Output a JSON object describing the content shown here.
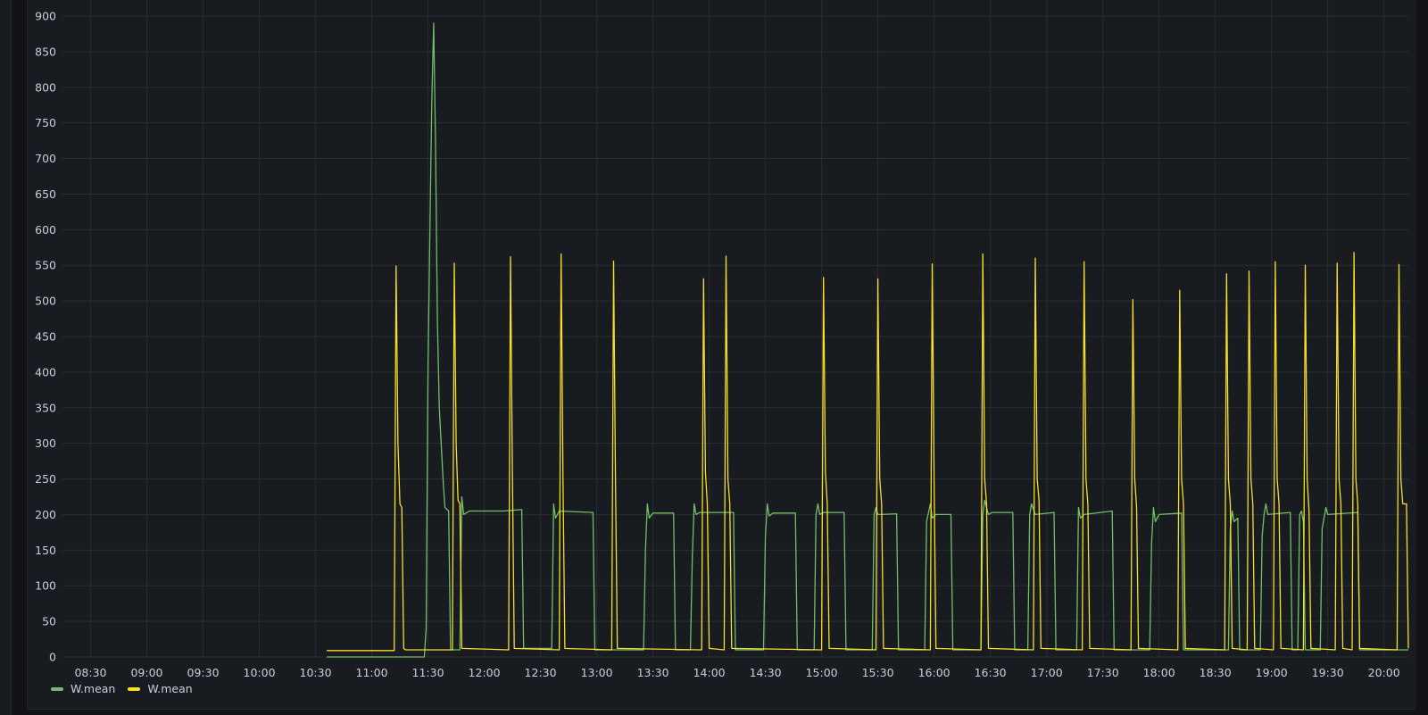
{
  "chart_data": {
    "type": "line",
    "title": "",
    "xlabel": "",
    "ylabel": "",
    "x_range": [
      "08:15",
      "20:13"
    ],
    "ylim": [
      0,
      900
    ],
    "y_ticks": [
      0,
      50,
      100,
      150,
      200,
      250,
      300,
      350,
      400,
      450,
      500,
      550,
      600,
      650,
      700,
      750,
      800,
      850,
      900
    ],
    "x_ticks": [
      "08:30",
      "09:00",
      "09:30",
      "10:00",
      "10:30",
      "11:00",
      "11:30",
      "12:00",
      "12:30",
      "13:00",
      "13:30",
      "14:00",
      "14:30",
      "15:00",
      "15:30",
      "16:00",
      "16:30",
      "17:00",
      "17:30",
      "18:00",
      "18:30",
      "19:00",
      "19:30",
      "20:00"
    ],
    "grid": true,
    "legend_position": "bottom-left",
    "series": [
      {
        "name": "W.mean",
        "color": "#73bf69",
        "points": [
          [
            "10:36",
            0
          ],
          [
            "11:28",
            0
          ],
          [
            "11:29",
            40
          ],
          [
            "11:30",
            410
          ],
          [
            "11:31",
            600
          ],
          [
            "11:32",
            780
          ],
          [
            "11:33",
            890
          ],
          [
            "11:34",
            720
          ],
          [
            "11:35",
            470
          ],
          [
            "11:36",
            350
          ],
          [
            "11:37",
            300
          ],
          [
            "11:38",
            250
          ],
          [
            "11:39",
            210
          ],
          [
            "11:41",
            205
          ],
          [
            "11:42",
            10
          ],
          [
            "11:47",
            10
          ],
          [
            "11:48",
            225
          ],
          [
            "11:49",
            200
          ],
          [
            "11:52",
            205
          ],
          [
            "12:10",
            205
          ],
          [
            "12:20",
            207
          ],
          [
            "12:21",
            12
          ],
          [
            "12:36",
            12
          ],
          [
            "12:37",
            215
          ],
          [
            "12:38",
            195
          ],
          [
            "12:40",
            205
          ],
          [
            "12:58",
            203
          ],
          [
            "12:59",
            10
          ],
          [
            "13:25",
            10
          ],
          [
            "13:26",
            150
          ],
          [
            "13:27",
            215
          ],
          [
            "13:28",
            195
          ],
          [
            "13:30",
            202
          ],
          [
            "13:41",
            202
          ],
          [
            "13:42",
            10
          ],
          [
            "13:50",
            10
          ],
          [
            "13:51",
            140
          ],
          [
            "13:52",
            215
          ],
          [
            "13:53",
            200
          ],
          [
            "13:55",
            203
          ],
          [
            "14:13",
            203
          ],
          [
            "14:14",
            10
          ],
          [
            "14:29",
            10
          ],
          [
            "14:30",
            170
          ],
          [
            "14:31",
            215
          ],
          [
            "14:32",
            198
          ],
          [
            "14:34",
            202
          ],
          [
            "14:46",
            202
          ],
          [
            "14:47",
            10
          ],
          [
            "14:56",
            10
          ],
          [
            "14:57",
            200
          ],
          [
            "14:58",
            215
          ],
          [
            "14:59",
            200
          ],
          [
            "15:01",
            203
          ],
          [
            "15:12",
            203
          ],
          [
            "15:13",
            10
          ],
          [
            "15:27",
            10
          ],
          [
            "15:28",
            200
          ],
          [
            "15:29",
            210
          ],
          [
            "15:30",
            200
          ],
          [
            "15:32",
            200
          ],
          [
            "15:40",
            201
          ],
          [
            "15:41",
            10
          ],
          [
            "15:55",
            10
          ],
          [
            "15:56",
            190
          ],
          [
            "15:58",
            215
          ],
          [
            "15:59",
            195
          ],
          [
            "16:01",
            200
          ],
          [
            "16:09",
            200
          ],
          [
            "16:10",
            10
          ],
          [
            "16:25",
            10
          ],
          [
            "16:26",
            200
          ],
          [
            "16:27",
            220
          ],
          [
            "16:29",
            200
          ],
          [
            "16:31",
            203
          ],
          [
            "16:42",
            203
          ],
          [
            "16:43",
            10
          ],
          [
            "16:50",
            10
          ],
          [
            "16:51",
            200
          ],
          [
            "16:52",
            215
          ],
          [
            "16:54",
            200
          ],
          [
            "17:04",
            203
          ],
          [
            "17:05",
            10
          ],
          [
            "17:16",
            10
          ],
          [
            "17:17",
            210
          ],
          [
            "17:18",
            195
          ],
          [
            "17:20",
            200
          ],
          [
            "17:35",
            205
          ],
          [
            "17:36",
            10
          ],
          [
            "17:55",
            10
          ],
          [
            "17:56",
            160
          ],
          [
            "17:57",
            210
          ],
          [
            "17:58",
            190
          ],
          [
            "18:00",
            200
          ],
          [
            "18:12",
            202
          ],
          [
            "18:13",
            10
          ],
          [
            "18:37",
            10
          ],
          [
            "18:38",
            180
          ],
          [
            "18:39",
            205
          ],
          [
            "18:40",
            190
          ],
          [
            "18:42",
            195
          ],
          [
            "18:43",
            10
          ],
          [
            "18:54",
            10
          ],
          [
            "18:55",
            170
          ],
          [
            "18:56",
            200
          ],
          [
            "18:57",
            215
          ],
          [
            "18:58",
            200
          ],
          [
            "19:10",
            203
          ],
          [
            "19:11",
            10
          ],
          [
            "19:14",
            10
          ],
          [
            "19:15",
            200
          ],
          [
            "19:16",
            205
          ],
          [
            "19:17",
            190
          ],
          [
            "19:18",
            10
          ],
          [
            "19:26",
            10
          ],
          [
            "19:27",
            180
          ],
          [
            "19:28",
            195
          ],
          [
            "19:29",
            210
          ],
          [
            "19:30",
            200
          ],
          [
            "19:46",
            203
          ],
          [
            "19:47",
            10
          ],
          [
            "20:05",
            10
          ],
          [
            "20:13",
            10
          ]
        ]
      },
      {
        "name": "W.mean",
        "color": "#fade2a",
        "points": [
          [
            "10:36",
            9
          ],
          [
            "11:12",
            9
          ],
          [
            "11:13",
            549
          ],
          [
            "11:14",
            300
          ],
          [
            "11:15",
            215
          ],
          [
            "11:16",
            210
          ],
          [
            "11:17",
            12
          ],
          [
            "11:18",
            10
          ],
          [
            "11:43",
            10
          ],
          [
            "11:44",
            553
          ],
          [
            "11:45",
            300
          ],
          [
            "11:46",
            220
          ],
          [
            "11:47",
            215
          ],
          [
            "11:48",
            12
          ],
          [
            "12:13",
            10
          ],
          [
            "12:14",
            562
          ],
          [
            "12:15",
            260
          ],
          [
            "12:16",
            12
          ],
          [
            "12:40",
            10
          ],
          [
            "12:41",
            566
          ],
          [
            "12:42",
            250
          ],
          [
            "12:43",
            12
          ],
          [
            "13:08",
            10
          ],
          [
            "13:09",
            556
          ],
          [
            "13:10",
            250
          ],
          [
            "13:11",
            12
          ],
          [
            "13:56",
            10
          ],
          [
            "13:57",
            531
          ],
          [
            "13:58",
            260
          ],
          [
            "13:59",
            215
          ],
          [
            "14:00",
            12
          ],
          [
            "14:08",
            10
          ],
          [
            "14:09",
            563
          ],
          [
            "14:10",
            250
          ],
          [
            "14:11",
            215
          ],
          [
            "14:12",
            12
          ],
          [
            "15:00",
            10
          ],
          [
            "15:01",
            533
          ],
          [
            "15:02",
            260
          ],
          [
            "15:03",
            215
          ],
          [
            "15:04",
            12
          ],
          [
            "15:29",
            10
          ],
          [
            "15:30",
            531
          ],
          [
            "15:31",
            250
          ],
          [
            "15:32",
            215
          ],
          [
            "15:33",
            12
          ],
          [
            "15:58",
            10
          ],
          [
            "15:59",
            552
          ],
          [
            "16:00",
            250
          ],
          [
            "16:01",
            12
          ],
          [
            "16:25",
            10
          ],
          [
            "16:26",
            566
          ],
          [
            "16:27",
            250
          ],
          [
            "16:28",
            215
          ],
          [
            "16:29",
            12
          ],
          [
            "16:53",
            10
          ],
          [
            "16:54",
            560
          ],
          [
            "16:55",
            250
          ],
          [
            "16:56",
            220
          ],
          [
            "16:57",
            12
          ],
          [
            "17:19",
            10
          ],
          [
            "17:20",
            555
          ],
          [
            "17:21",
            250
          ],
          [
            "17:22",
            215
          ],
          [
            "17:23",
            12
          ],
          [
            "17:45",
            10
          ],
          [
            "17:46",
            502
          ],
          [
            "17:47",
            250
          ],
          [
            "17:48",
            210
          ],
          [
            "17:49",
            12
          ],
          [
            "18:10",
            10
          ],
          [
            "18:11",
            515
          ],
          [
            "18:12",
            250
          ],
          [
            "18:13",
            215
          ],
          [
            "18:14",
            12
          ],
          [
            "18:35",
            10
          ],
          [
            "18:36",
            538
          ],
          [
            "18:37",
            250
          ],
          [
            "18:38",
            215
          ],
          [
            "18:39",
            12
          ],
          [
            "18:47",
            10
          ],
          [
            "18:48",
            542
          ],
          [
            "18:49",
            250
          ],
          [
            "18:50",
            215
          ],
          [
            "18:51",
            12
          ],
          [
            "19:01",
            10
          ],
          [
            "19:02",
            555
          ],
          [
            "19:03",
            250
          ],
          [
            "19:04",
            215
          ],
          [
            "19:05",
            12
          ],
          [
            "19:17",
            10
          ],
          [
            "19:18",
            550
          ],
          [
            "19:19",
            250
          ],
          [
            "19:20",
            205
          ],
          [
            "19:21",
            12
          ],
          [
            "19:34",
            10
          ],
          [
            "19:35",
            553
          ],
          [
            "19:36",
            250
          ],
          [
            "19:37",
            215
          ],
          [
            "19:38",
            12
          ],
          [
            "19:43",
            10
          ],
          [
            "19:44",
            568
          ],
          [
            "19:45",
            250
          ],
          [
            "19:46",
            215
          ],
          [
            "19:47",
            12
          ],
          [
            "20:07",
            10
          ],
          [
            "20:08",
            551
          ],
          [
            "20:09",
            250
          ],
          [
            "20:10",
            215
          ],
          [
            "20:12",
            215
          ],
          [
            "20:13",
            12
          ]
        ]
      }
    ]
  },
  "legend": {
    "items": [
      {
        "label": "W.mean",
        "color": "#73bf69"
      },
      {
        "label": "W.mean",
        "color": "#fade2a"
      }
    ]
  }
}
